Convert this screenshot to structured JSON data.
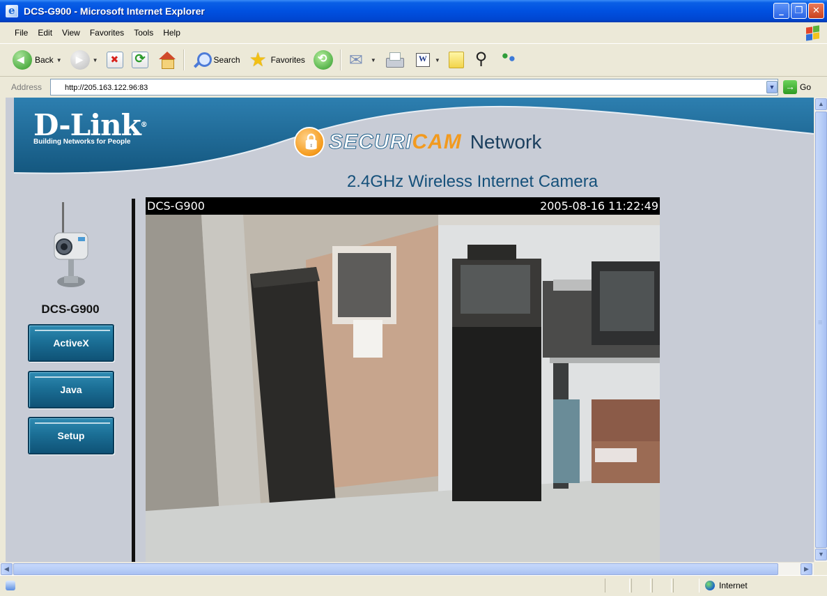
{
  "window": {
    "title": "DCS-G900 - Microsoft Internet Explorer"
  },
  "menu": [
    "File",
    "Edit",
    "View",
    "Favorites",
    "Tools",
    "Help"
  ],
  "toolbar": {
    "back_label": "Back",
    "search_label": "Search",
    "favorites_label": "Favorites"
  },
  "address": {
    "label": "Address",
    "url": "http://205.163.122.96:83",
    "go_label": "Go"
  },
  "page": {
    "brand": "D-Link",
    "brand_mark": "®",
    "tagline": "Building Networks for People",
    "secure_a": "SECURI",
    "secure_b": "CAM",
    "secure_c": "Network",
    "product_title": "2.4GHz Wireless Internet Camera",
    "model": "DCS-G900",
    "buttons": [
      "ActiveX",
      "Java",
      "Setup"
    ],
    "video": {
      "camera_name": "DCS-G900",
      "timestamp": "2005-08-16 11:22:49"
    }
  },
  "statusbar": {
    "zone": "Internet"
  },
  "colors": {
    "header_band": "#1f6b9a",
    "accent_orange": "#f29a1f",
    "button_blue": "#1b6f96",
    "page_bg": "#c8ccd6"
  }
}
